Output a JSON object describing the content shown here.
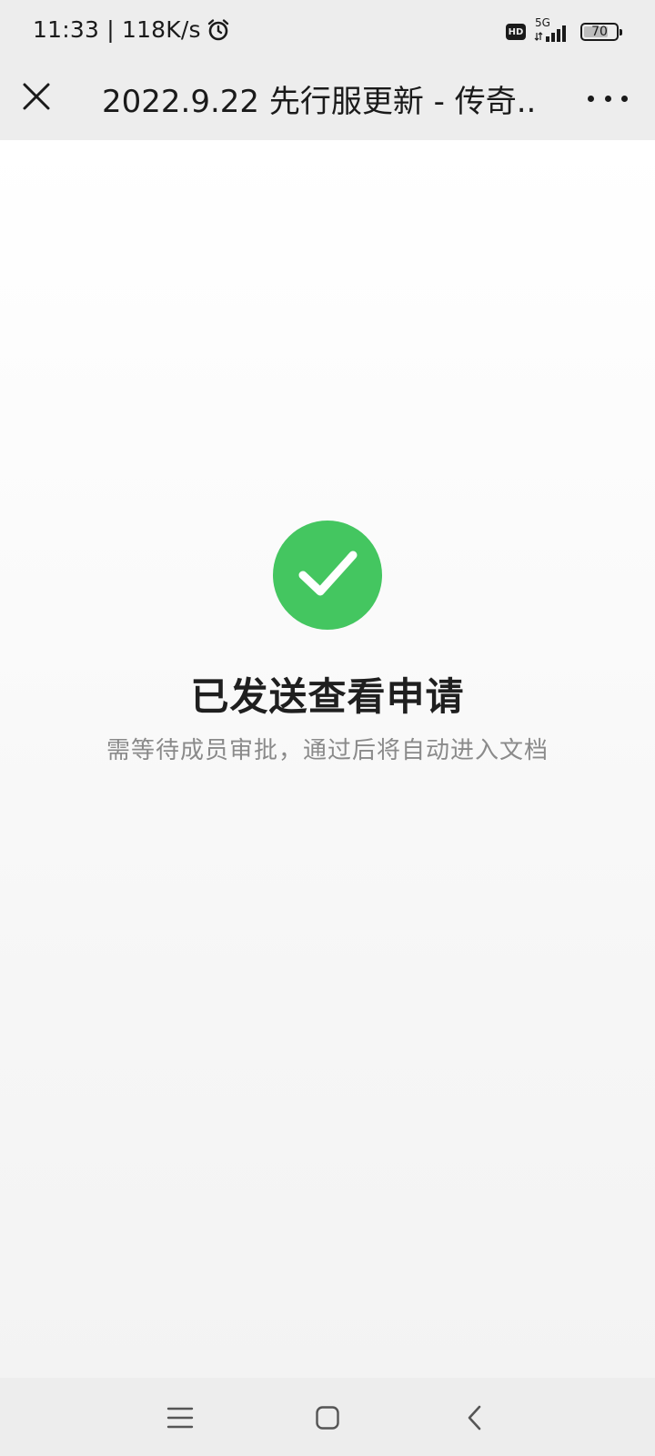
{
  "status_bar": {
    "time_speed": "11:33 | 118K/s",
    "network": "5G",
    "hd": "HD",
    "battery": "70",
    "icons": [
      "alarm-icon",
      "hd-icon",
      "signal-icon",
      "battery-icon"
    ]
  },
  "nav": {
    "title": "2022.9.22 先行服更新 - 传奇...",
    "close_icon": "close-icon",
    "more_icon": "more-icon"
  },
  "result": {
    "icon": "check-circle-icon",
    "title": "已发送查看申请",
    "subtitle": "需等待成员审批，通过后将自动进入文档"
  },
  "bottom_nav": {
    "icons": [
      "menu-icon",
      "home-icon",
      "back-icon"
    ]
  },
  "colors": {
    "success": "#44c660",
    "text_primary": "#1f1f1f",
    "text_secondary": "#8a8a8a",
    "bar_bg": "#ededed"
  }
}
